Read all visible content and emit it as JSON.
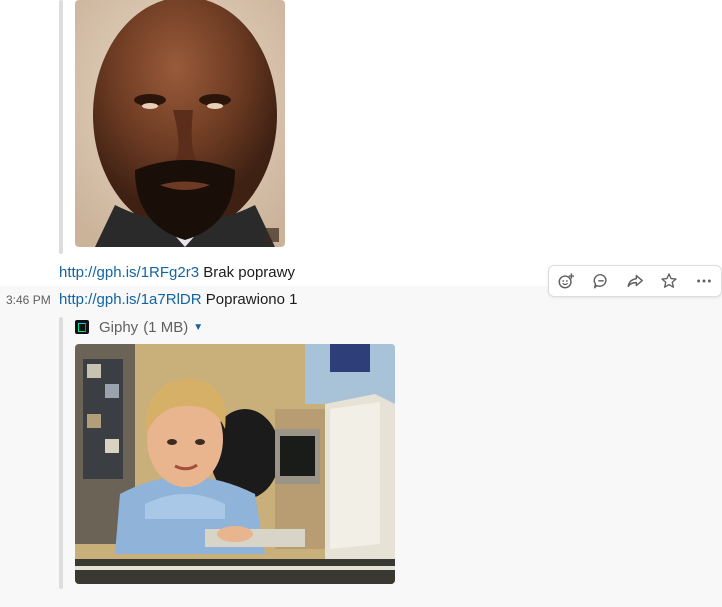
{
  "message_1": {
    "link": "http://gph.is/1RFg2r3",
    "text": "Brak poprawy"
  },
  "message_2": {
    "timestamp": "3:46 PM",
    "link": "http://gph.is/1a7RlDR",
    "text": "Poprawiono 1",
    "attachment": {
      "source": "Giphy",
      "size": "(1 MB)"
    }
  },
  "actions": [
    "add-reaction-icon",
    "reply-in-thread-icon",
    "share-icon",
    "star-icon",
    "more-actions-icon"
  ],
  "colors": {
    "link": "#1264a3",
    "hover_bg": "#f8f8f8",
    "divider": "#e8c9cf"
  }
}
